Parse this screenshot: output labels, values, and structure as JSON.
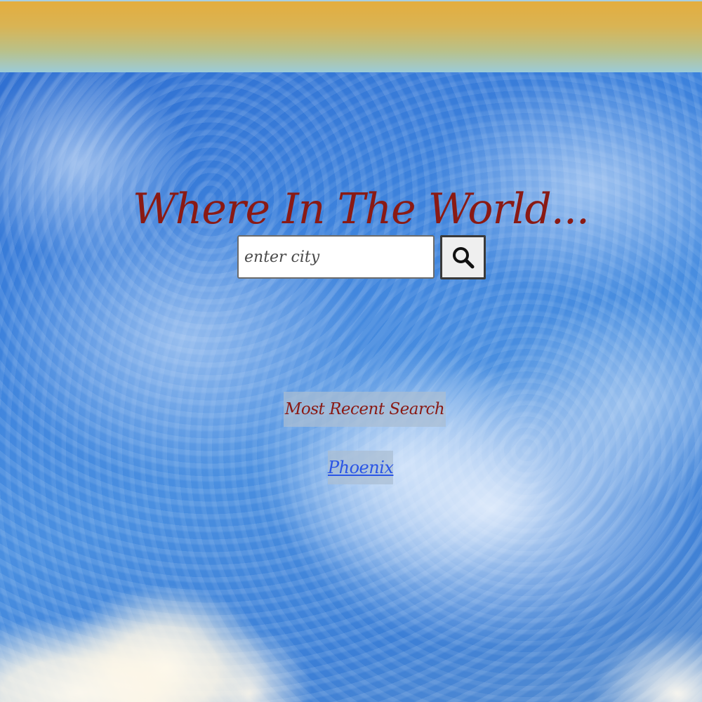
{
  "header": {
    "title": "Where In The World..."
  },
  "search": {
    "placeholder": "enter city",
    "value": "",
    "button_icon": "search-icon"
  },
  "recent": {
    "heading": "Most Recent Search",
    "items": [
      {
        "label": "Phoenix"
      }
    ]
  },
  "colors": {
    "title": "#8a1a14",
    "link": "#2a55e6",
    "banner_top": "#e4ad3e",
    "banner_bottom": "#9ccbd8",
    "sky": "#3f7fd3"
  }
}
